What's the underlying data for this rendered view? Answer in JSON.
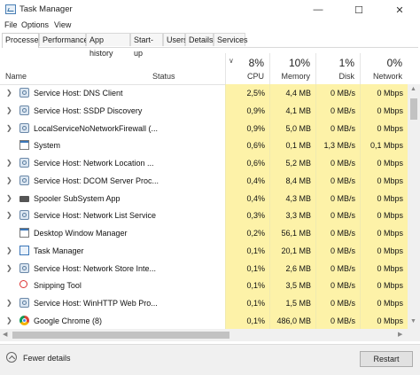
{
  "window": {
    "title": "Task Manager"
  },
  "menu": [
    "File",
    "Options",
    "View"
  ],
  "tabs": [
    "Processes",
    "Performance",
    "App history",
    "Start-up",
    "Users",
    "Details",
    "Services"
  ],
  "header": {
    "name": "Name",
    "status": "Status",
    "cpu": {
      "pct": "8%",
      "label": "CPU"
    },
    "memory": {
      "pct": "10%",
      "label": "Memory"
    },
    "disk": {
      "pct": "1%",
      "label": "Disk"
    },
    "network": {
      "pct": "0%",
      "label": "Network"
    }
  },
  "processes": [
    {
      "name": "Service Host: DNS Client",
      "icon": "gear-icon",
      "expand": true,
      "cpu": "2,5%",
      "memory": "4,4 MB",
      "disk": "0 MB/s",
      "network": "0 Mbps"
    },
    {
      "name": "Service Host: SSDP Discovery",
      "icon": "gear-icon",
      "expand": true,
      "cpu": "0,9%",
      "memory": "4,1 MB",
      "disk": "0 MB/s",
      "network": "0 Mbps"
    },
    {
      "name": "LocalServiceNoNetworkFirewall (...",
      "icon": "gear-icon",
      "expand": true,
      "cpu": "0,9%",
      "memory": "5,0 MB",
      "disk": "0 MB/s",
      "network": "0 Mbps"
    },
    {
      "name": "System",
      "icon": "window-icon",
      "expand": false,
      "cpu": "0,6%",
      "memory": "0,1 MB",
      "disk": "1,3 MB/s",
      "network": "0,1 Mbps"
    },
    {
      "name": "Service Host: Network Location ...",
      "icon": "gear-icon",
      "expand": true,
      "cpu": "0,6%",
      "memory": "5,2 MB",
      "disk": "0 MB/s",
      "network": "0 Mbps"
    },
    {
      "name": "Service Host: DCOM Server Proc...",
      "icon": "gear-icon",
      "expand": true,
      "cpu": "0,4%",
      "memory": "8,4 MB",
      "disk": "0 MB/s",
      "network": "0 Mbps"
    },
    {
      "name": "Spooler SubSystem App",
      "icon": "printer-icon",
      "expand": true,
      "cpu": "0,4%",
      "memory": "4,3 MB",
      "disk": "0 MB/s",
      "network": "0 Mbps"
    },
    {
      "name": "Service Host: Network List Service",
      "icon": "gear-icon",
      "expand": true,
      "cpu": "0,3%",
      "memory": "3,3 MB",
      "disk": "0 MB/s",
      "network": "0 Mbps"
    },
    {
      "name": "Desktop Window Manager",
      "icon": "window-icon",
      "expand": false,
      "cpu": "0,2%",
      "memory": "56,1 MB",
      "disk": "0 MB/s",
      "network": "0 Mbps"
    },
    {
      "name": "Task Manager",
      "icon": "task-manager-icon",
      "expand": true,
      "cpu": "0,1%",
      "memory": "20,1 MB",
      "disk": "0 MB/s",
      "network": "0 Mbps"
    },
    {
      "name": "Service Host: Network Store Inte...",
      "icon": "gear-icon",
      "expand": true,
      "cpu": "0,1%",
      "memory": "2,6 MB",
      "disk": "0 MB/s",
      "network": "0 Mbps"
    },
    {
      "name": "Snipping Tool",
      "icon": "scissors-icon",
      "expand": false,
      "cpu": "0,1%",
      "memory": "3,5 MB",
      "disk": "0 MB/s",
      "network": "0 Mbps"
    },
    {
      "name": "Service Host: WinHTTP Web Pro...",
      "icon": "gear-icon",
      "expand": true,
      "cpu": "0,1%",
      "memory": "1,5 MB",
      "disk": "0 MB/s",
      "network": "0 Mbps"
    },
    {
      "name": "Google Chrome (8)",
      "icon": "chrome-icon",
      "expand": true,
      "cpu": "0,1%",
      "memory": "486,0 MB",
      "disk": "0 MB/s",
      "network": "0 Mbps"
    }
  ],
  "footer": {
    "fewer_details": "Fewer details",
    "restart": "Restart"
  }
}
